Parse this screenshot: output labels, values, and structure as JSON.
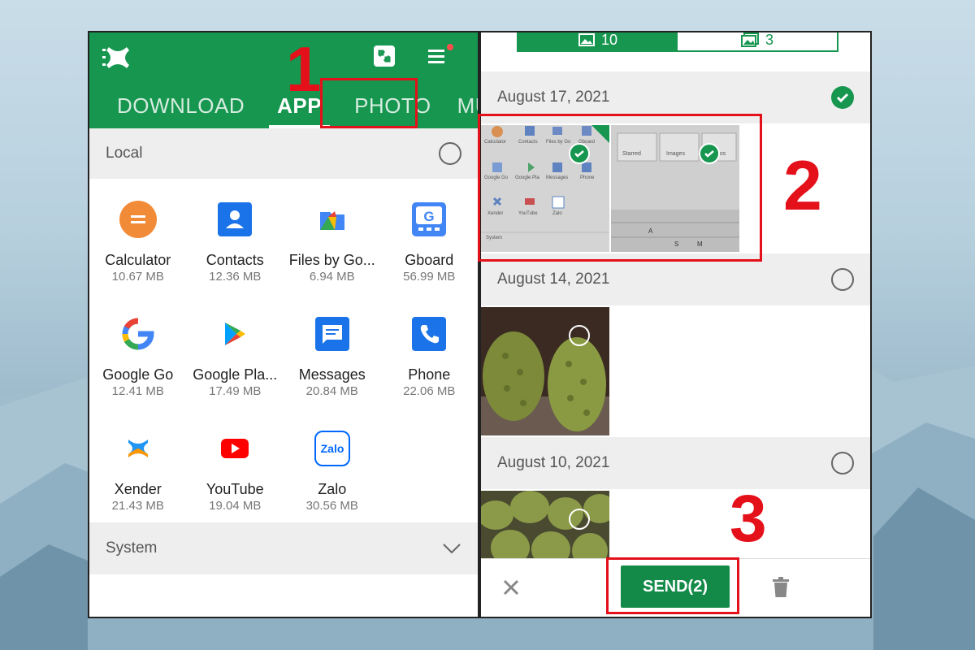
{
  "left": {
    "tabs": [
      {
        "label": "DOWNLOAD"
      },
      {
        "label": "APP"
      },
      {
        "label": "PHOTO"
      },
      {
        "label": "MUS"
      }
    ],
    "local_section": {
      "label": "Local"
    },
    "apps": [
      {
        "name": "Calculator",
        "size": "10.67 MB",
        "icon": "calculator-icon",
        "color": "#f28b38"
      },
      {
        "name": "Contacts",
        "size": "12.36 MB",
        "icon": "contacts-icon",
        "color": "#1a73e8"
      },
      {
        "name": "Files by Go...",
        "size": "6.94 MB",
        "icon": "files-icon",
        "color": "#4285f4"
      },
      {
        "name": "Gboard",
        "size": "56.99 MB",
        "icon": "gboard-icon",
        "color": "#4285f4"
      },
      {
        "name": "Google Go",
        "size": "12.41 MB",
        "icon": "google-go-icon",
        "color": "#4285f4"
      },
      {
        "name": "Google Pla...",
        "size": "17.49 MB",
        "icon": "google-play-icon",
        "color": "#34a853"
      },
      {
        "name": "Messages",
        "size": "20.84 MB",
        "icon": "messages-icon",
        "color": "#1a73e8"
      },
      {
        "name": "Phone",
        "size": "22.06 MB",
        "icon": "phone-icon",
        "color": "#1a73e8"
      },
      {
        "name": "Xender",
        "size": "21.43 MB",
        "icon": "xender-icon",
        "color": "#2196f3"
      },
      {
        "name": "YouTube",
        "size": "19.04 MB",
        "icon": "youtube-icon",
        "color": "#ff0000"
      },
      {
        "name": "Zalo",
        "size": "30.56 MB",
        "icon": "zalo-icon",
        "color": "#0068ff"
      }
    ],
    "system_section": {
      "label": "System"
    }
  },
  "right": {
    "top_tabs": [
      {
        "label": "10",
        "icon": "image-icon"
      },
      {
        "label": "3",
        "icon": "album-icon"
      }
    ],
    "groups": [
      {
        "date": "August 17, 2021",
        "selected": true
      },
      {
        "date": "August 14, 2021",
        "selected": false
      },
      {
        "date": "August 10, 2021",
        "selected": false
      }
    ],
    "screenshot_thumbs": {
      "apps": [
        "Calculator",
        "Contacts",
        "Files by Go",
        "Gboard",
        "Google Go",
        "Google Pla",
        "Messages",
        "Phone",
        "Xender",
        "YouTube",
        "Zalo"
      ],
      "system_label": "System",
      "quick_items": [
        "Starred",
        "Images",
        "Videos"
      ],
      "keys": [
        "A",
        "S",
        "M"
      ]
    },
    "send_button": {
      "label": "SEND(2)"
    }
  },
  "annotations": {
    "step1": "1",
    "step2": "2",
    "step3": "3"
  },
  "colors": {
    "brand_green": "#16964f",
    "annotation_red": "#e4101a"
  }
}
